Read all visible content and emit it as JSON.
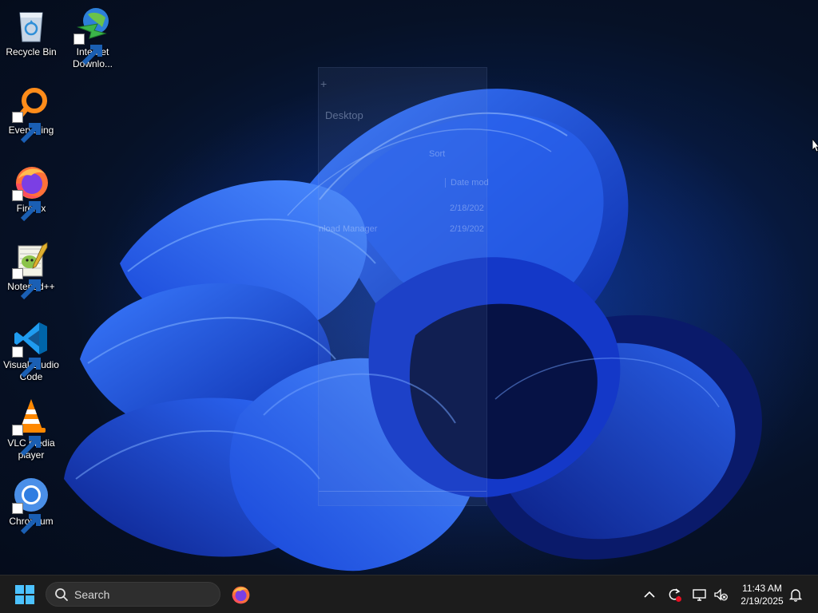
{
  "desktop": {
    "icons": [
      {
        "label": "Recycle Bin",
        "icon": "recycle-bin-icon"
      },
      {
        "label": "Internet Downlo...",
        "icon": "internet-download-manager-icon"
      },
      {
        "label": "Everything",
        "icon": "everything-search-icon"
      },
      {
        "label": "Firefox",
        "icon": "firefox-icon"
      },
      {
        "label": "Notepad++",
        "icon": "notepad-plus-plus-icon"
      },
      {
        "label": "Visual Studio Code",
        "icon": "vscode-icon"
      },
      {
        "label": "VLC media player",
        "icon": "vlc-icon"
      },
      {
        "label": "Chromium",
        "icon": "chromium-icon"
      }
    ]
  },
  "ghost_window": {
    "title": "Desktop",
    "plus": "+",
    "sort_label": "Sort",
    "date_column": "Date mod",
    "row1_date": "2/18/202",
    "row2_name": "nload Manager",
    "row2_date": "2/19/202"
  },
  "taskbar": {
    "search_placeholder": "Search",
    "clock_time": "11:43 AM",
    "clock_date": "2/19/2025"
  },
  "colors": {
    "taskbar_bg": "#1c1c1c",
    "search_bg": "#2e2e2e",
    "start_blue": "#4cc2ff",
    "wallpaper_blue": "#1f4fe0"
  }
}
